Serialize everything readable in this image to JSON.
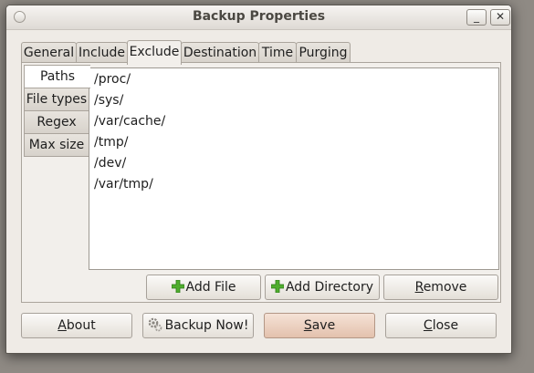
{
  "window": {
    "title": "Backup Properties",
    "minimize_label": "_",
    "close_label": "✕"
  },
  "tabs": [
    "General",
    "Include",
    "Exclude",
    "Destination",
    "Time",
    "Purging"
  ],
  "active_tab": "Exclude",
  "subtabs": [
    "Paths",
    "File types",
    "Regex",
    "Max size"
  ],
  "active_subtab": "Paths",
  "paths": [
    "/proc/",
    "/sys/",
    "/var/cache/",
    "/tmp/",
    "/dev/",
    "/var/tmp/"
  ],
  "list_buttons": {
    "add_file": "Add File",
    "add_directory": "Add Directory",
    "remove_first": "R",
    "remove_rest": "emove"
  },
  "bottom_buttons": {
    "about_first": "A",
    "about_rest": "bout",
    "backup_now": "Backup Now!",
    "save_first": "S",
    "save_rest": "ave",
    "close_first": "C",
    "close_rest": "lose"
  },
  "colors": {
    "plus_icon": "#4fae2e",
    "primary_button": "#e3c1ad"
  },
  "icons": {
    "add": "plus-icon",
    "backup": "gear-icon"
  }
}
